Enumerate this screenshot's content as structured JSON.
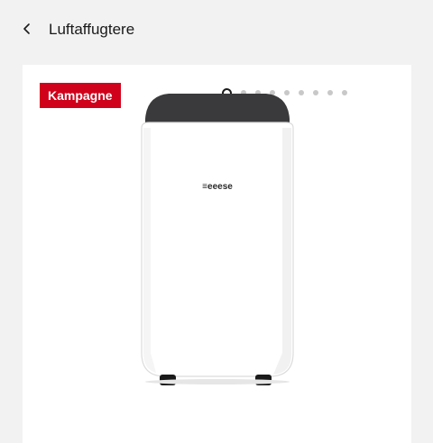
{
  "header": {
    "back_icon": "chevron-left-icon",
    "title": "Luftaffugtere"
  },
  "product_card": {
    "badge": "Kampagne",
    "badge_color": "#d0021b",
    "carousel": {
      "total": 9,
      "active_index": 0
    },
    "image": {
      "kind": "portable dehumidifier",
      "brand": "≡eeese"
    }
  }
}
